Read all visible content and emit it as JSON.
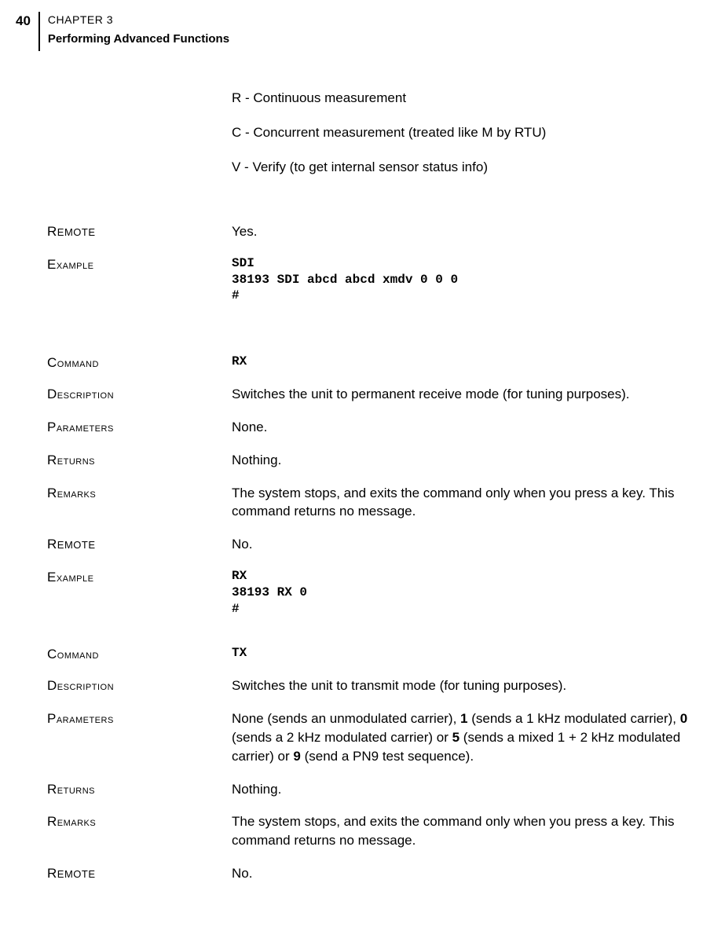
{
  "header": {
    "page_number": "40",
    "chapter_label": "CHAPTER 3",
    "chapter_title": "Performing Advanced Functions"
  },
  "intro": {
    "item1": "R - Continuous measurement",
    "item2": "C - Concurrent measurement (treated like M by RTU)",
    "item3": "V - Verify (to get internal sensor status info)"
  },
  "block1": {
    "remote_label": "REMOTE",
    "remote_value": "Yes.",
    "example_label": "Example",
    "example_value": "SDI\n38193 SDI abcd abcd xmdv 0 0 0\n#"
  },
  "block2": {
    "command_label": "Command",
    "command_value": "RX",
    "description_label": "Description",
    "description_value": "Switches the unit to permanent receive mode (for tuning purposes).",
    "parameters_label": "Parameters",
    "parameters_value": "None.",
    "returns_label": "Returns",
    "returns_value": "Nothing.",
    "remarks_label": "Remarks",
    "remarks_value": "The system stops, and exits the command only when you press a key. This command returns no message.",
    "remote_label": "REMOTE",
    "remote_value": "No.",
    "example_label": "Example",
    "example_value": "RX\n38193 RX 0\n#"
  },
  "block3": {
    "command_label": "Command",
    "command_value": "TX",
    "description_label": "Description",
    "description_value": "Switches the unit to transmit mode (for tuning purposes).",
    "parameters_label": "Parameters",
    "parameters_prefix": "None (sends an unmodulated carrier), ",
    "parameters_b1": "1",
    "parameters_mid1": " (sends a 1 kHz modulated carrier), ",
    "parameters_b0": "0",
    "parameters_mid2": " (sends a 2 kHz modulated carrier) or ",
    "parameters_b5": "5",
    "parameters_mid3": " (sends a mixed 1 + 2 kHz modulated carrier) or ",
    "parameters_b9": "9",
    "parameters_suffix": " (send a PN9 test sequence).",
    "returns_label": "Returns",
    "returns_value": "Nothing.",
    "remarks_label": "Remarks",
    "remarks_value": "The system stops, and exits the command only when you press a key. This command returns no message.",
    "remote_label": "REMOTE",
    "remote_value": "No."
  }
}
